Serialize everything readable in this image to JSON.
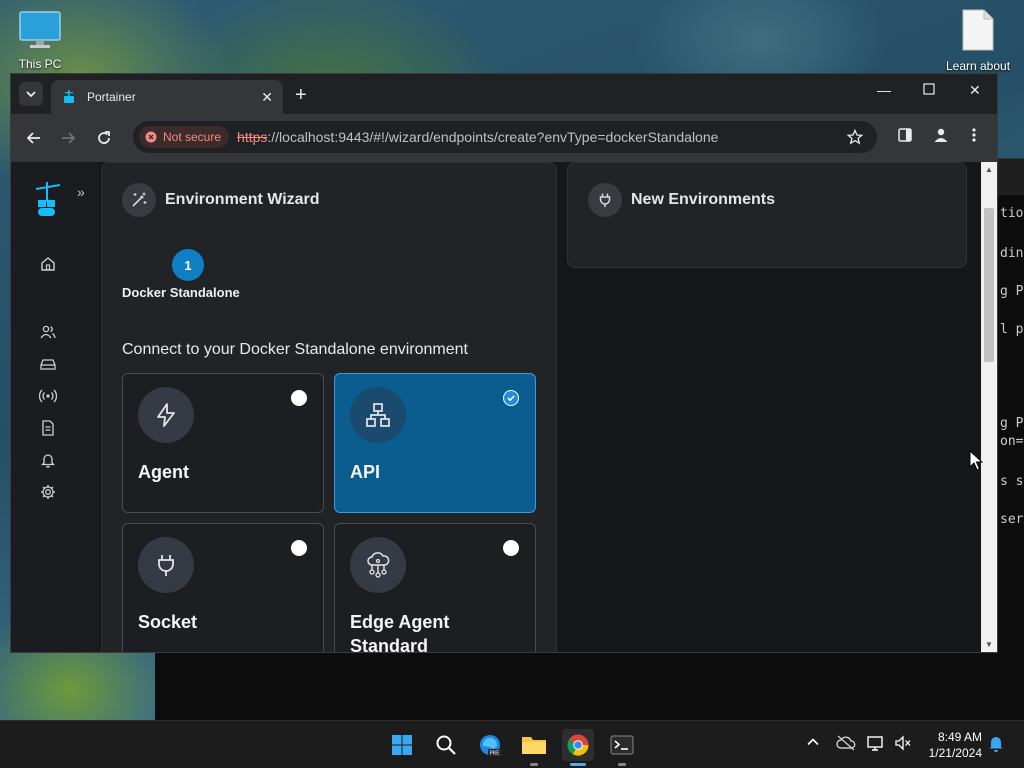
{
  "desktop": {
    "icons": [
      {
        "label": "This PC"
      },
      {
        "label": "Learn about"
      }
    ],
    "terminal_fragments": [
      "tion",
      "ding",
      "g Po",
      "l p",
      "g P",
      "on=",
      "s se",
      "ser"
    ]
  },
  "browser": {
    "tab": {
      "title": "Portainer"
    },
    "omnibox": {
      "security_label": "Not secure",
      "url_scheme": "https",
      "url_rest": "://localhost:9443/#!/wizard/endpoints/create?envType=dockerStandalone"
    }
  },
  "wizard": {
    "title": "Environment Wizard",
    "step_number": "1",
    "step_label": "Docker Standalone",
    "connect_title": "Connect to your Docker Standalone environment",
    "options": [
      {
        "label": "Agent",
        "icon": "bolt-icon",
        "selected": false
      },
      {
        "label": "API",
        "icon": "network-icon",
        "selected": true
      },
      {
        "label": "Socket",
        "icon": "plug-icon",
        "selected": false
      },
      {
        "label": "Edge Agent Standard",
        "icon": "cloud-network-icon",
        "selected": false
      }
    ]
  },
  "new_environments": {
    "title": "New Environments"
  },
  "taskbar": {
    "time": "8:49 AM",
    "date": "1/21/2024"
  },
  "colors": {
    "accent": "#0d7fc2",
    "selected_card": "#0b5d8f",
    "not_secure": "#f28b82"
  }
}
